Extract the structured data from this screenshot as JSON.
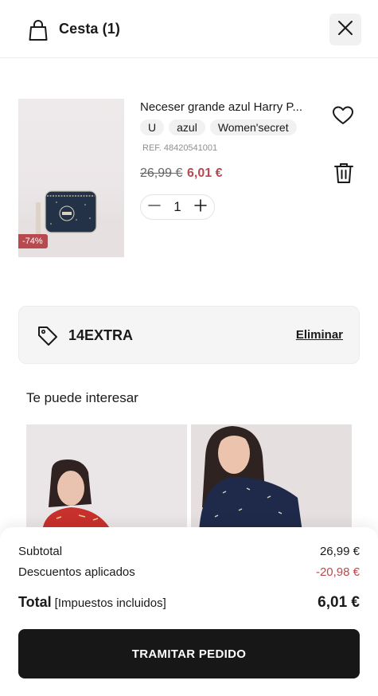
{
  "header": {
    "title": "Cesta (1)",
    "bag_icon": "shopping-bag-icon",
    "close_icon": "close-icon"
  },
  "product": {
    "name": "Neceser grande azul Harry P...",
    "chips": [
      "U",
      "azul",
      "Women'secret"
    ],
    "ref_label": "REF.",
    "ref_value": "48420541001",
    "price_old": "26,99 €",
    "price_new": "6,01 €",
    "discount_badge": "-74%",
    "quantity": "1",
    "icons": {
      "favorite": "heart-icon",
      "delete": "trash-icon",
      "minus": "minus-icon",
      "plus": "plus-icon"
    }
  },
  "promo": {
    "code": "14EXTRA",
    "remove_label": "Eliminar",
    "icon": "tag-icon"
  },
  "recommendations": {
    "title": "Te puede interesar"
  },
  "summary": {
    "subtotal_label": "Subtotal",
    "subtotal_value": "26,99 €",
    "discounts_label": "Descuentos aplicados",
    "discounts_value": "-20,98 €",
    "total_label": "Total",
    "total_note": "[Impuestos incluidos]",
    "total_value": "6,01 €",
    "checkout_label": "TRAMITAR PEDIDO"
  },
  "colors": {
    "accent": "#b84a4f",
    "button": "#171717",
    "chip": "#f1f1f1"
  }
}
